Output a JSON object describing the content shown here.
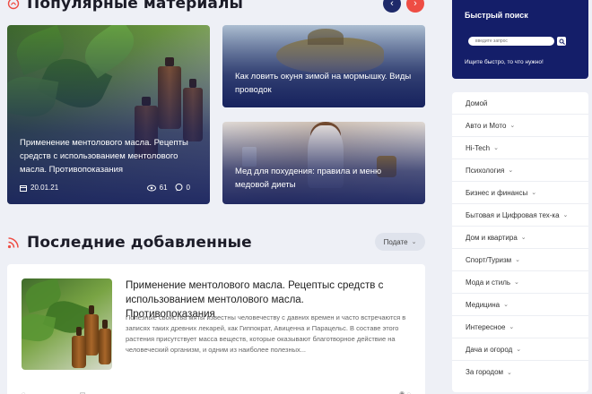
{
  "popular": {
    "heading": "Популярные материалы",
    "cards": [
      {
        "title": "Применение ментолового масла. Рецепты средств с использованием ментолового масла. Противопоказания",
        "date": "20.01.21",
        "views": "61",
        "comments": "0"
      },
      {
        "title": "Как ловить окуня зимой на мормышку. Виды проводок"
      },
      {
        "title": "Мед для похудения: правила и меню медовой диеты"
      }
    ]
  },
  "latest": {
    "heading": "Последние добавленные",
    "sort_label": "Подате",
    "post": {
      "title": "Применение ментолового масла. Рецептыс средств с использованием ментолового масла. Противопоказания",
      "excerpt": "Полезные свойства мяты известны человечеству с давних времен и часто встречаются в записях таких древних лекарей, как Гиппократ, Авиценна и Парацельс. В составе этого растения присутствует масса веществ, которые оказывают благотворное действие на человеческий организм, и одним из наиболее полезных..."
    }
  },
  "sidebar": {
    "search": {
      "title": "Быстрый поиск",
      "placeholder": "введите запрос",
      "note": "Ищите быстро, то что нужно!"
    },
    "categories": [
      {
        "label": "Домой",
        "has_children": false
      },
      {
        "label": "Авто и Мото",
        "has_children": true
      },
      {
        "label": "Hi-Tech",
        "has_children": true
      },
      {
        "label": "Психология",
        "has_children": true
      },
      {
        "label": "Бизнес и финансы",
        "has_children": true
      },
      {
        "label": "Бытовая и Цифровая тех-ка",
        "has_children": true
      },
      {
        "label": "Дом и квартира",
        "has_children": true
      },
      {
        "label": "Спорт/Туризм",
        "has_children": true
      },
      {
        "label": "Мода и стиль",
        "has_children": true
      },
      {
        "label": "Медицина",
        "has_children": true
      },
      {
        "label": "Интересное",
        "has_children": true
      },
      {
        "label": "Дача и огород",
        "has_children": true
      },
      {
        "label": "За городом",
        "has_children": true
      }
    ]
  },
  "colors": {
    "navy": "#141e69",
    "accent_red": "#ee4d44",
    "page_bg": "#eef0f6"
  },
  "icons": {
    "popular": "fire-icon",
    "latest": "rss-icon",
    "prev": "chevron-left-icon",
    "next": "chevron-right-icon",
    "date": "calendar-icon",
    "views": "eye-icon",
    "comments": "comment-icon",
    "search": "search-icon"
  }
}
